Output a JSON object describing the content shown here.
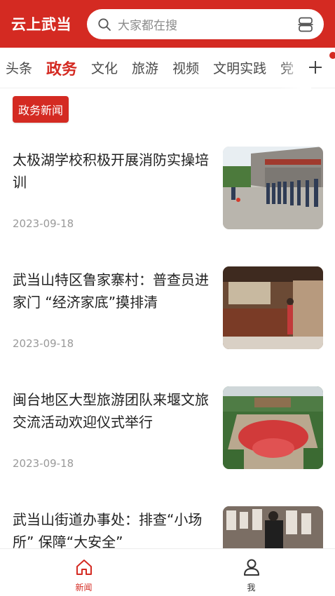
{
  "header": {
    "app_title": "云上武当",
    "search_placeholder": "大家都在搜",
    "search_icon": "search-icon",
    "scan_icon": "scan-icon",
    "brand_color": "#d42a22"
  },
  "tabs": {
    "items": [
      "头条",
      "政务",
      "文化",
      "旅游",
      "视频",
      "文明实践",
      "党"
    ],
    "active": "政务",
    "add_icon": "plus-icon"
  },
  "section": {
    "tag": "政务新闻"
  },
  "news": [
    {
      "title": "太极湖学校积极开展消防实操培训",
      "date": "2023-09-18"
    },
    {
      "title": "武当山特区鲁家寨村：普查员进家门 “经济家底”摸排清",
      "date": "2023-09-18"
    },
    {
      "title": "闽台地区大型旅游团队来堰文旅交流活动欢迎仪式举行",
      "date": "2023-09-18"
    },
    {
      "title": "武当山街道办事处：排查“小场所” 保障“大安全”",
      "date": ""
    }
  ],
  "bottom_nav": {
    "items": [
      {
        "label": "新闻",
        "icon": "home-icon",
        "active": true
      },
      {
        "label": "我",
        "icon": "user-icon",
        "active": false
      }
    ]
  }
}
